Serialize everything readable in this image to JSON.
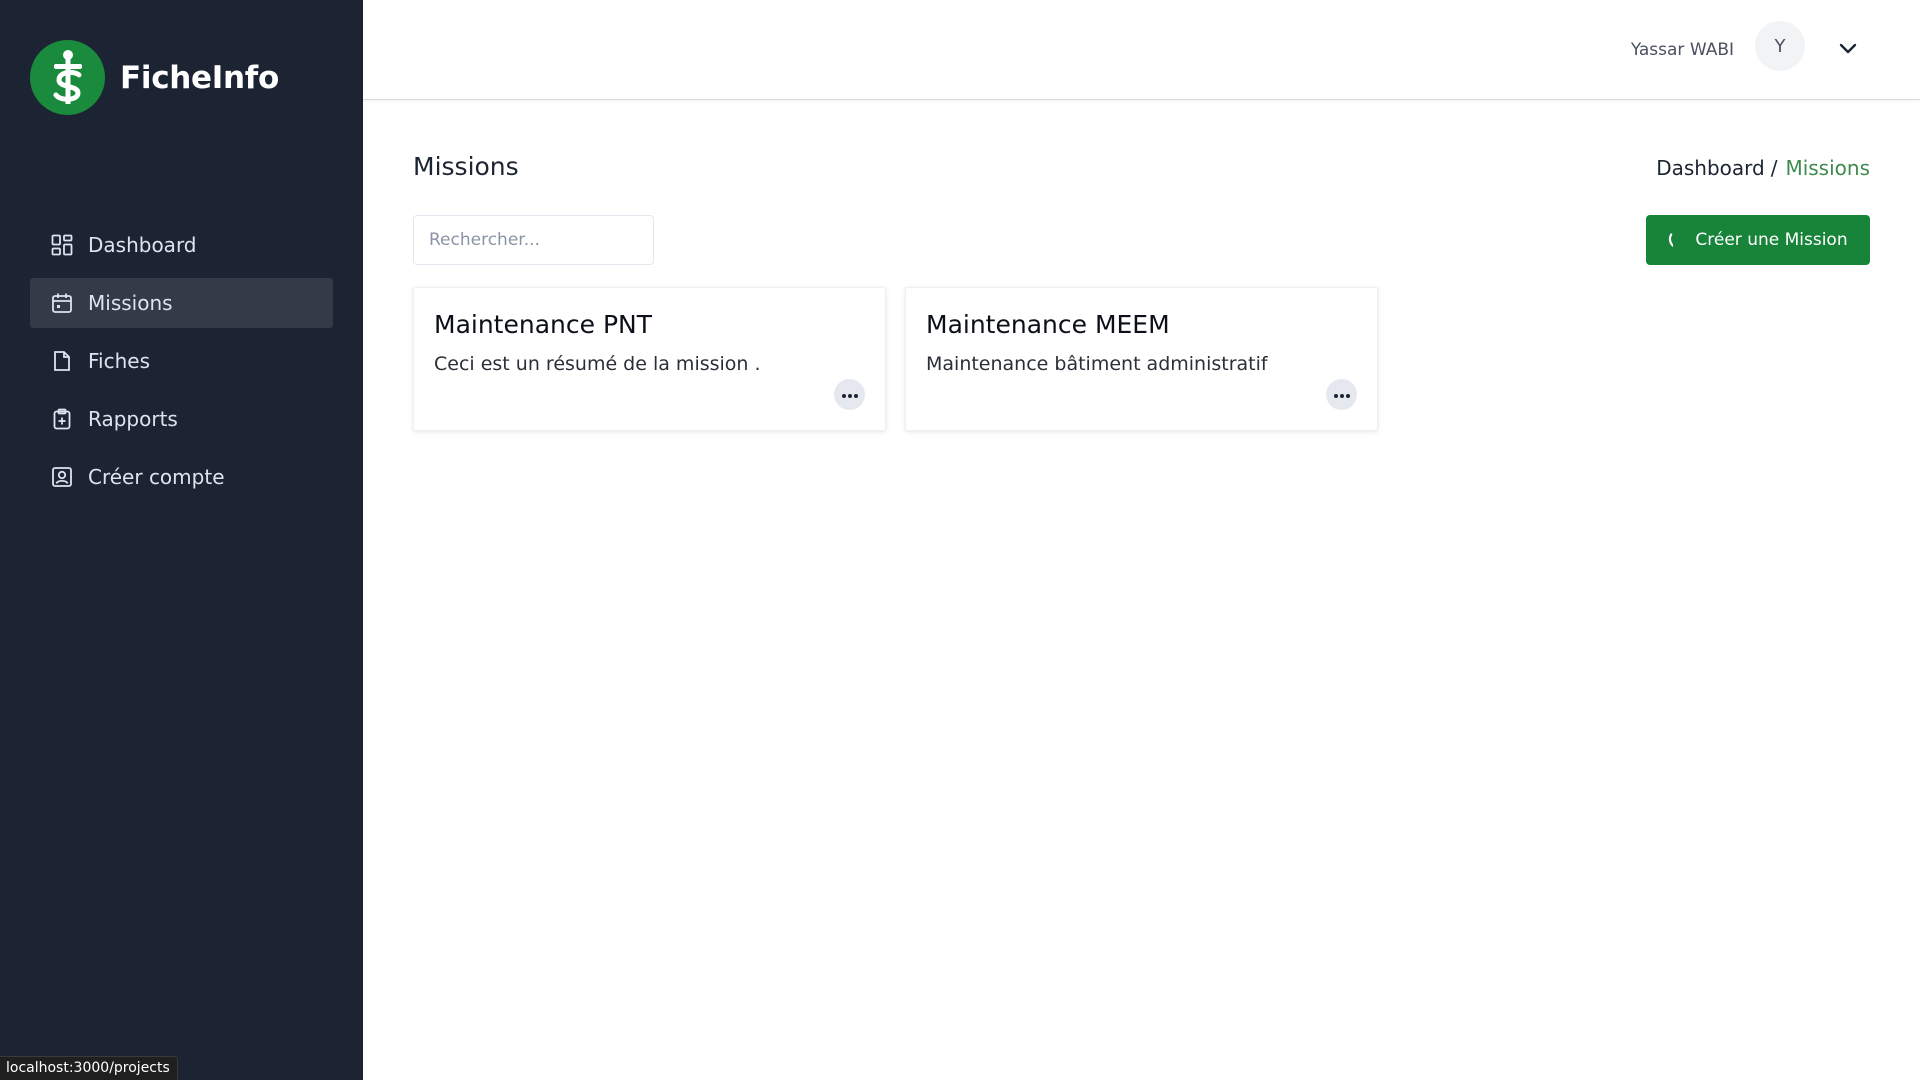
{
  "app": {
    "name": "FicheInfo",
    "brand_color": "#1a8a3c"
  },
  "sidebar": {
    "items": [
      {
        "label": "Dashboard",
        "icon": "dashboard-grid-icon",
        "active": false
      },
      {
        "label": "Missions",
        "icon": "calendar-icon",
        "active": true
      },
      {
        "label": "Fiches",
        "icon": "file-icon",
        "active": false
      },
      {
        "label": "Rapports",
        "icon": "clipboard-plus-icon",
        "active": false
      },
      {
        "label": "Créer compte",
        "icon": "user-square-icon",
        "active": false
      }
    ]
  },
  "header": {
    "user_name": "Yassar WABI",
    "avatar_initial": "Y"
  },
  "main": {
    "page_title": "Missions",
    "breadcrumb": {
      "root": "Dashboard",
      "separator": "/",
      "current": "Missions"
    },
    "search": {
      "placeholder": "Rechercher...",
      "value": ""
    },
    "create_button_label": "Créer une Mission",
    "cards": [
      {
        "title": "Maintenance PNT",
        "description": "Ceci est un résumé de la mission ."
      },
      {
        "title": "Maintenance MEEM",
        "description": "Maintenance bâtiment administratif"
      }
    ]
  },
  "status_bar": {
    "url": "localhost:3000/projects"
  },
  "colors": {
    "sidebar_bg": "#1c2434",
    "sidebar_active_bg": "#333a48",
    "accent_green": "#17843a",
    "breadcrumb_active": "#3f8a4f"
  }
}
